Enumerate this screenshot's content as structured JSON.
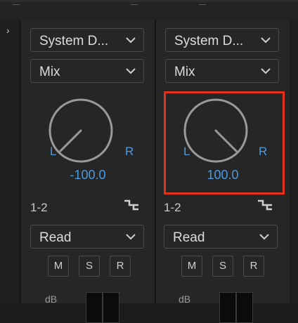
{
  "sidebar": {
    "expand_icon": "chevron-right-icon",
    "expand_glyph": "›"
  },
  "channels": [
    {
      "output": "System D...",
      "mode": "Mix",
      "pan": {
        "left_label": "L",
        "right_label": "R",
        "value": "-100.0"
      },
      "channel_label": "1-2",
      "automation": "Read",
      "buttons": {
        "mute": "M",
        "solo": "S",
        "record": "R"
      },
      "db_label": "dB"
    },
    {
      "output": "System D...",
      "mode": "Mix",
      "pan": {
        "left_label": "L",
        "right_label": "R",
        "value": "100.0"
      },
      "channel_label": "1-2",
      "automation": "Read",
      "buttons": {
        "mute": "M",
        "solo": "S",
        "record": "R"
      },
      "db_label": "dB"
    }
  ],
  "colors": {
    "accent": "#4a9be0",
    "highlight": "#e0321c"
  }
}
